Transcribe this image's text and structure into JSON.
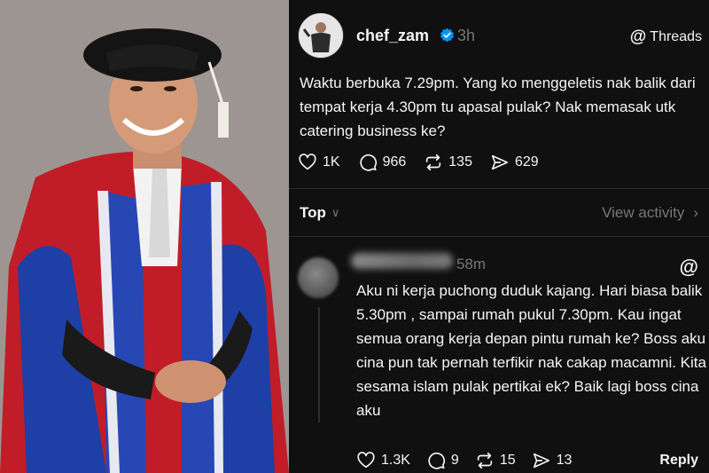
{
  "photo": {
    "alt": "Man in academic doctoral gown and cap"
  },
  "post": {
    "username": "chef_zam",
    "time": "3h",
    "brand": "Threads",
    "text": "Waktu berbuka 7.29pm.  Yang ko menggeletis nak balik dari tempat kerja 4.30pm tu apasal pulak?  Nak memasak utk catering business ke?",
    "likes": "1K",
    "comments": "966",
    "reposts": "135",
    "shares": "629"
  },
  "sort": {
    "label": "Top"
  },
  "view_activity": "View activity",
  "reply": {
    "time": "58m",
    "text": "Aku ni kerja puchong duduk kajang.  Hari biasa balik 5.30pm , sampai rumah pukul 7.30pm. Kau ingat semua orang kerja depan pintu rumah ke? Boss aku cina pun tak pernah terfikir nak cakap macamni. Kita sesama islam pulak pertikai ek? Baik lagi boss cina aku",
    "likes": "1.3K",
    "comments": "9",
    "reposts": "15",
    "shares": "13",
    "reply_label": "Reply"
  },
  "colors": {
    "bg": "#101010",
    "text": "#f3f5f7",
    "muted": "#777777",
    "verified": "#0095f6",
    "divider": "#2a2a2a"
  }
}
